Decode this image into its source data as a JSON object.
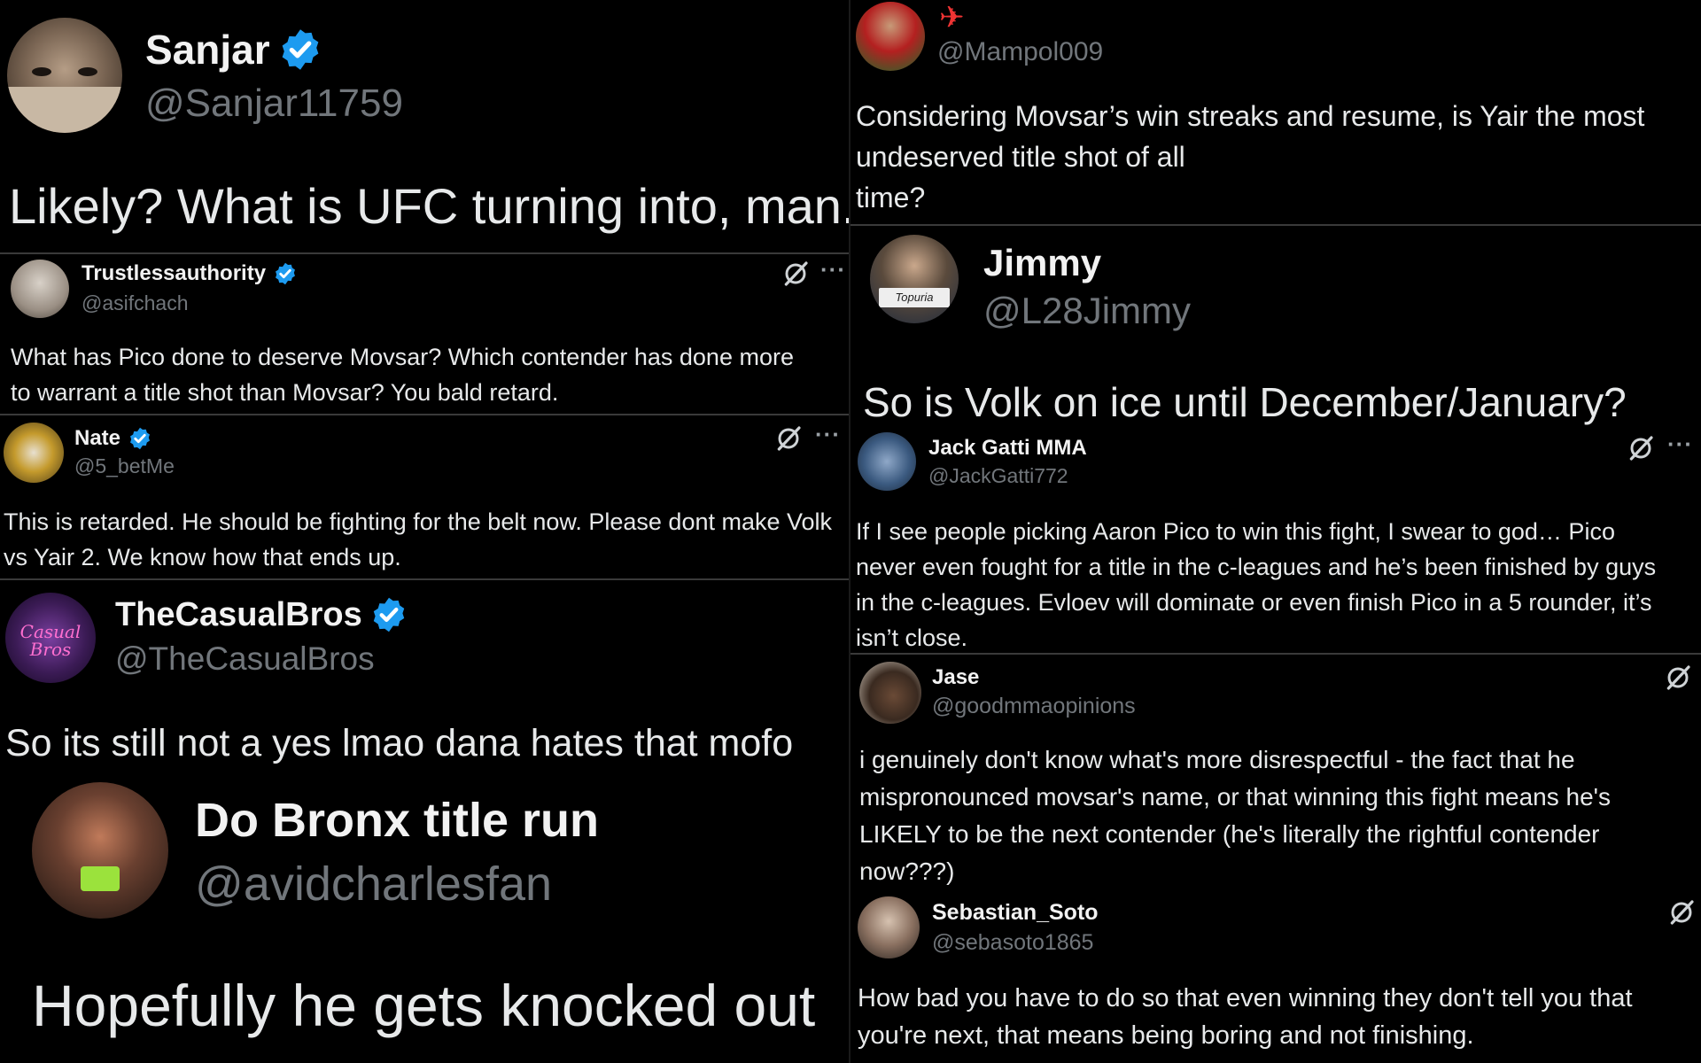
{
  "colors": {
    "verified": "#1d9bf0",
    "background": "#000000",
    "handle": "#71767b",
    "text": "#e7e9ea"
  },
  "icons": {
    "verified": "verified-badge-icon",
    "grok": "grok-slash-icon",
    "more": "more-icon",
    "plane_emoji": "airplane-icon"
  },
  "tweets": {
    "sanjar": {
      "name": "Sanjar",
      "handle": "@Sanjar11759",
      "text": "Likely? What is UFC turning into, man."
    },
    "trustless": {
      "name": "Trustlessauthority",
      "handle": "@asifchach",
      "text": "What has Pico done to deserve Movsar? Which contender has done more to warrant a title shot than Movsar? You bald retard."
    },
    "nate": {
      "name": "Nate",
      "handle": "@5_betMe",
      "text": "This is retarded. He should be fighting for the belt now. Please dont make Volk vs Yair 2. We know how that ends up."
    },
    "casualbros": {
      "name": "TheCasualBros",
      "handle": "@TheCasualBros",
      "text": "So its still not a yes lmao dana hates that mofo"
    },
    "bronx": {
      "name": "Do Bronx title run",
      "handle": "@avidcharlesfan",
      "text": "Hopefully he gets knocked out"
    },
    "mampol": {
      "handle": "@Mampol009",
      "text": "Considering Movsar’s win streaks and resume, is Yair the most undeserved title shot of all time?",
      "line1": "Considering Movsar’s win streaks and resume, is Yair the most",
      "line2": "undeserved title shot of all",
      "line3": "time?"
    },
    "jimmy": {
      "name": "Jimmy",
      "handle": "@L28Jimmy",
      "text": "So is Volk on ice until December/January?",
      "avatar_caption": "Topuria"
    },
    "jackgatti": {
      "name": "Jack Gatti MMA",
      "handle": "@JackGatti772",
      "text": "If I see people picking Aaron Pico to win this fight, I swear to god… Pico never even fought for a title in the c-leagues and he’s been finished by guys in the c-leagues. Evloev will dominate or even finish Pico in a 5 rounder, it’s isn’t close."
    },
    "jase": {
      "name": "Jase",
      "handle": "@goodmmaopinions",
      "text": "i genuinely don't know what's more disrespectful - the fact that he mispronounced movsar's name, or that winning this fight means he's LIKELY to be the next contender (he's literally the rightful contender now???)"
    },
    "sebastian": {
      "name": "Sebastian_Soto",
      "handle": "@sebasoto1865",
      "text": "How bad you have to do so that even winning they don't tell you that you're next, that means being boring and not finishing."
    }
  }
}
